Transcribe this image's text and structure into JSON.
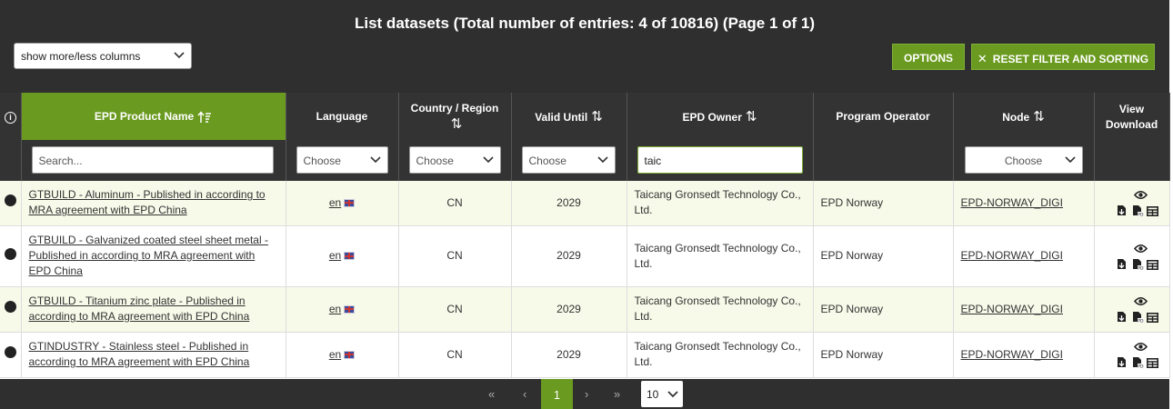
{
  "header": {
    "title": "List datasets (Total number of entries: 4 of 10816) (Page 1 of 1)",
    "columns_select": "show more/less columns",
    "options_label": "OPTIONS",
    "reset_label": "RESET FILTER AND SORTING",
    "reset_icon": "close-icon"
  },
  "columns": {
    "info_icon": "i",
    "product_name": "EPD Product Name",
    "language": "Language",
    "country": "Country / Region",
    "valid_until": "Valid Until",
    "owner": "EPD Owner",
    "operator": "Program Operator",
    "node": "Node",
    "view1": "View",
    "view2": "Download"
  },
  "filters": {
    "product_name_placeholder": "Search...",
    "language": "Choose",
    "country": "Choose",
    "valid_until": "Choose",
    "owner_value": "taic",
    "node": "Choose"
  },
  "rows": [
    {
      "name": "GTBUILD - Aluminum - Published in according to MRA agreement with EPD China",
      "lang": "en",
      "country": "CN",
      "valid": "2029",
      "owner": "Taicang Gronsedt Technology Co., Ltd.",
      "operator": "EPD Norway",
      "node": "EPD-NORWAY_DIGI"
    },
    {
      "name": "GTBUILD - Galvanized coated steel sheet metal - Published in according to MRA agreement with EPD China",
      "lang": "en",
      "country": "CN",
      "valid": "2029",
      "owner": "Taicang Gronsedt Technology Co., Ltd.",
      "operator": "EPD Norway",
      "node": "EPD-NORWAY_DIGI"
    },
    {
      "name": "GTBUILD - Titanium zinc plate - Published in according to MRA agreement with EPD China",
      "lang": "en",
      "country": "CN",
      "valid": "2029",
      "owner": "Taicang Gronsedt Technology Co., Ltd.",
      "operator": "EPD Norway",
      "node": "EPD-NORWAY_DIGI"
    },
    {
      "name": "GTINDUSTRY - Stainless steel - Published in according to MRA agreement with EPD China",
      "lang": "en",
      "country": "CN",
      "valid": "2029",
      "owner": "Taicang Gronsedt Technology Co., Ltd.",
      "operator": "EPD Norway",
      "node": "EPD-NORWAY_DIGI"
    }
  ],
  "pagination": {
    "first": "«",
    "prev": "‹",
    "current": "1",
    "next": "›",
    "last": "»",
    "page_size": "10"
  },
  "colors": {
    "accent": "#6a9a1f",
    "dark": "#2f2f2f",
    "row_alt": "#f7fae9"
  }
}
